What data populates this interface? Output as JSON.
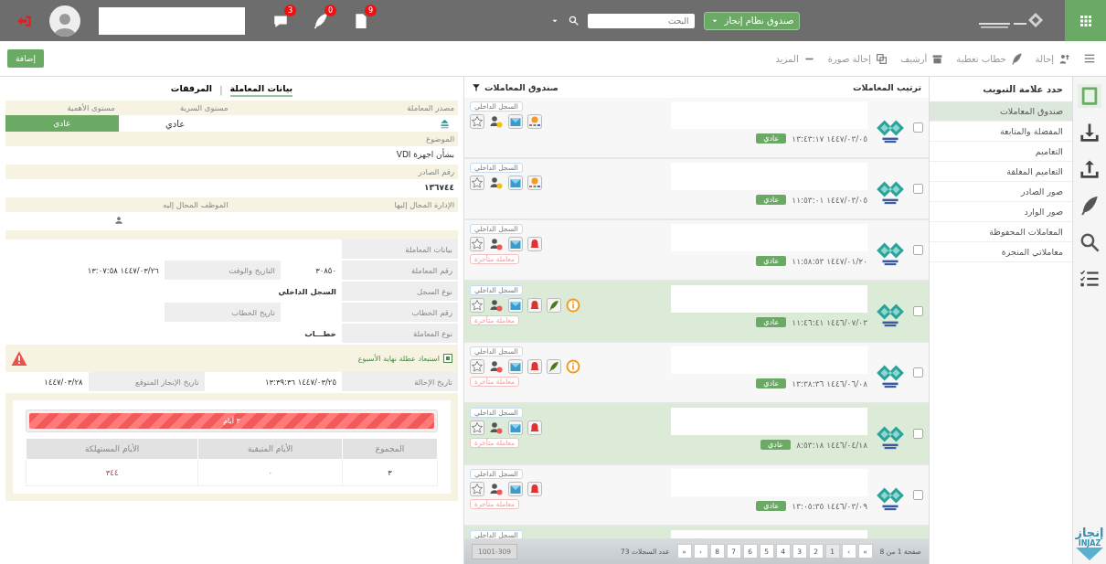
{
  "top_bar": {
    "system_dropdown": "صندوق نظام إنجاز",
    "search": {
      "placeholder": "البحث"
    },
    "notifications": [
      {
        "kind": "document",
        "count": "9"
      },
      {
        "kind": "feather",
        "count": "0"
      },
      {
        "kind": "chat",
        "count": "3"
      }
    ]
  },
  "toolbar": {
    "actions": [
      {
        "kind": "share",
        "label": "إحالة"
      },
      {
        "kind": "feather",
        "label": "خطاب تغطية"
      },
      {
        "kind": "archive",
        "label": "أرشيف"
      },
      {
        "kind": "copy",
        "label": "إحالة صورة"
      },
      {
        "kind": "dash",
        "label": "المزيد"
      }
    ],
    "add_button": "إضافة"
  },
  "rail": [
    {
      "kind": "book",
      "selected": true
    },
    {
      "kind": "download",
      "selected": false
    },
    {
      "kind": "upload",
      "selected": false
    },
    {
      "kind": "feather",
      "selected": false
    },
    {
      "kind": "search",
      "selected": false
    },
    {
      "kind": "checklist",
      "selected": false
    }
  ],
  "rail_logo": {
    "arabic": "إنجاز",
    "latin": "INJAZ"
  },
  "sidebar": {
    "title": "حدد علامة التبويب",
    "items": [
      {
        "label": "صندوق المعاملات",
        "selected": true
      },
      {
        "label": "المفضلة والمتابعة",
        "selected": false
      },
      {
        "label": "التعاميم",
        "selected": false
      },
      {
        "label": "التعاميم المغلقة",
        "selected": false
      },
      {
        "label": "صور الصادر",
        "selected": false
      },
      {
        "label": "صور الوارد",
        "selected": false
      },
      {
        "label": "المعاملات المحفوظة",
        "selected": false
      },
      {
        "label": "معاملاتي المنجزة",
        "selected": false
      }
    ]
  },
  "inbox": {
    "sort_label": "ترتيب المعاملات",
    "title": "صندوق المعاملات",
    "rows": [
      {
        "checked": false,
        "highlighted": false,
        "date": "١٤٤٧/٠٣/٠٥ ١٣:٤٣:١٧",
        "priority": "عادي",
        "register": "السجل الداخلي",
        "icons": [
          {
            "kind": "star"
          },
          {
            "kind": "person-yellow"
          },
          {
            "kind": "envelope"
          },
          {
            "kind": "org"
          }
        ]
      },
      {
        "checked": false,
        "highlighted": false,
        "date": "١٤٤٧/٠٣/٠٥ ١١:٥٣:٠١",
        "priority": "عادي",
        "register": "السجل الداخلي",
        "icons": [
          {
            "kind": "star"
          },
          {
            "kind": "person-yellow"
          },
          {
            "kind": "envelope"
          },
          {
            "kind": "org"
          }
        ]
      },
      {
        "checked": false,
        "highlighted": false,
        "date": "١٤٤٧/٠١/٢٠ ١١:٥٨:٥٣",
        "priority": "عادي",
        "register": "السجل الداخلي",
        "icons": [
          {
            "kind": "star"
          },
          {
            "kind": "person-red"
          },
          {
            "kind": "envelope"
          },
          {
            "kind": "bell"
          }
        ],
        "late": "معاملة متأخرة"
      },
      {
        "checked": false,
        "highlighted": true,
        "date": "١٤٤٦/٠٧/٠٣ ١١:٤٦:٤١",
        "priority": "عادي",
        "register": "السجل الداخلي",
        "icons": [
          {
            "kind": "star"
          },
          {
            "kind": "person-red"
          },
          {
            "kind": "envelope"
          },
          {
            "kind": "bell"
          },
          {
            "kind": "feather"
          },
          {
            "kind": "info"
          }
        ],
        "late": "معاملة متأخرة"
      },
      {
        "checked": false,
        "highlighted": false,
        "date": "١٤٤٦/٠٦/٠٨ ١٣:٣٨:٣٦",
        "priority": "عادي",
        "register": "السجل الداخلي",
        "icons": [
          {
            "kind": "star"
          },
          {
            "kind": "person-red"
          },
          {
            "kind": "envelope"
          },
          {
            "kind": "bell"
          },
          {
            "kind": "feather"
          },
          {
            "kind": "info"
          }
        ],
        "late": "معاملة متأخرة"
      },
      {
        "checked": false,
        "highlighted": true,
        "date": "١٤٤٦/٠٤/١٨ ٨:٥٣:١٨",
        "priority": "عادي",
        "register": "السجل الداخلي",
        "icons": [
          {
            "kind": "star"
          },
          {
            "kind": "person-red"
          },
          {
            "kind": "envelope"
          },
          {
            "kind": "bell"
          }
        ],
        "late": "معاملة متأخرة"
      },
      {
        "checked": false,
        "highlighted": false,
        "date": "١٤٤٦/٠٣/٠٩ ١٣:٠٥:٣٥",
        "priority": "عادي",
        "register": "السجل الداخلي",
        "icons": [
          {
            "kind": "star"
          },
          {
            "kind": "person-red"
          },
          {
            "kind": "envelope"
          },
          {
            "kind": "bell"
          }
        ],
        "late": "معاملة متأخرة"
      },
      {
        "highlighted": true,
        "register": "السجل الداخلي"
      }
    ],
    "pagination": {
      "summary": "صفحة 1 من 8",
      "pages": [
        {
          "label": "«",
          "selected": false
        },
        {
          "label": "‹",
          "selected": false
        },
        {
          "label": "1",
          "selected": true
        },
        {
          "label": "2",
          "selected": false
        },
        {
          "label": "3",
          "selected": false
        },
        {
          "label": "4",
          "selected": false
        },
        {
          "label": "5",
          "selected": false
        },
        {
          "label": "6",
          "selected": false
        },
        {
          "label": "7",
          "selected": false
        },
        {
          "label": "8",
          "selected": false
        },
        {
          "label": "›",
          "selected": false
        },
        {
          "label": "»",
          "selected": false
        }
      ],
      "count_label": "عدد السجلات 73",
      "range": "1001-309"
    }
  },
  "details": {
    "tab_separator": "|",
    "tabs": [
      {
        "label": "بيانات المعاملة",
        "selected": true
      },
      {
        "label": "المرفقات",
        "selected": false
      }
    ],
    "header_fields": [
      {
        "label": "مصدر المعاملة",
        "kind": "icon"
      },
      {
        "label": "مستوى السرية",
        "kind": "text",
        "value": "عادي"
      },
      {
        "label": "مستوى الأهمية",
        "kind": "badge",
        "value": "عادي"
      }
    ],
    "subject": {
      "label": "الموضوع",
      "value": "بشأن اجهزة VDI"
    },
    "issue_number": {
      "label": "رقم الصادر",
      "value": "١٣٦٧٤٤"
    },
    "assignees": [
      {
        "label": "الإدارة المحال إليها",
        "kind": "empty"
      },
      {
        "label": "الموظف المحال إليه",
        "kind": "person"
      }
    ],
    "info_table": {
      "title": "بيانات المعاملة",
      "rows": [
        [
          {
            "label": "رقم المعاملة",
            "value": "٣٠٨٥٠"
          },
          {
            "label": "التاريخ والوقت",
            "value": "١٤٤٧/٠٣/٢٦ ١٣:٠٧:٥٨"
          }
        ],
        [
          {
            "label": "نوع السجل",
            "value": "السجل الداخلي"
          }
        ],
        [
          {
            "label": "رقم الخطاب"
          },
          {
            "label": "تاريخ الخطاب"
          }
        ],
        [
          {
            "label": "نوع المعاملة",
            "value": "خطـــاب"
          }
        ]
      ]
    },
    "exclude_weekend": {
      "label": "استبعاد عطلة نهاية الأسبوع",
      "checked": true
    },
    "dates": [
      {
        "label": "تاريخ الإحالة",
        "value": "١٤٤٧/٠٣/٢٥ ١٣:٣٩:٣٦"
      },
      {
        "label": "تاريخ الإنجاز المتوقع",
        "value": "١٤٤٧/٠٣/٢٨"
      }
    ],
    "progress": {
      "label": "٣ أيام",
      "level": 1
    },
    "summary": {
      "columns": [
        "المجموع",
        "الأيام المتبقية",
        "الأيام المستهلكة"
      ],
      "values": [
        "٣",
        "٠",
        "٣٤٤"
      ]
    }
  }
}
